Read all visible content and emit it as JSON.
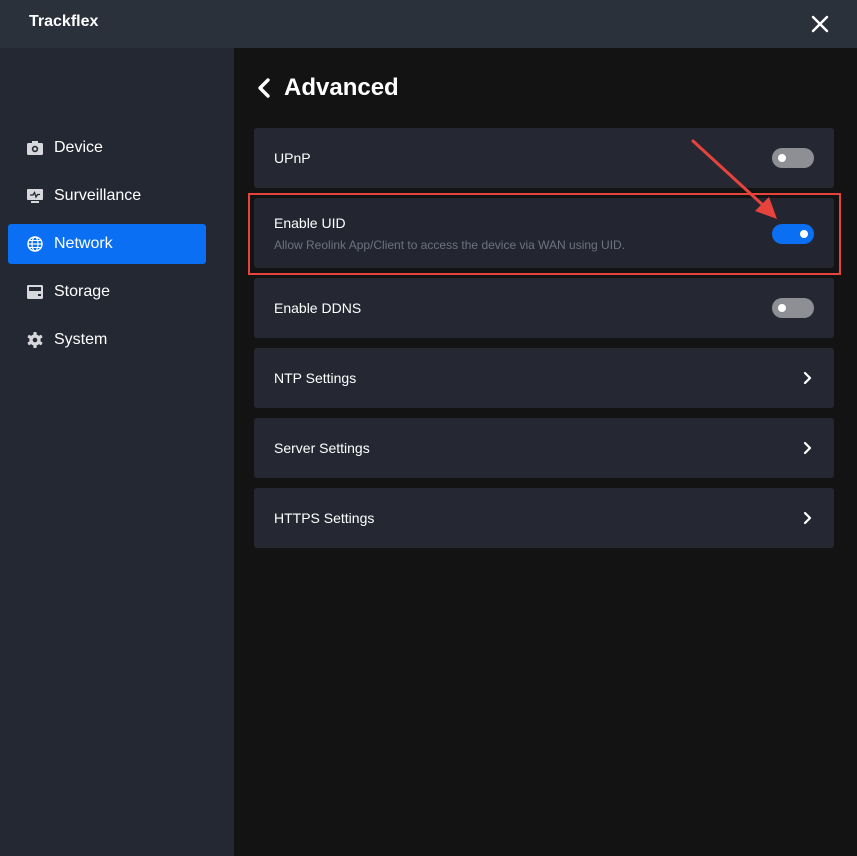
{
  "app": {
    "title": "Trackflex",
    "close_icon": "close-icon"
  },
  "sidebar": {
    "items": [
      {
        "label": "Device",
        "icon": "camera-icon",
        "active": false
      },
      {
        "label": "Surveillance",
        "icon": "monitor-icon",
        "active": false
      },
      {
        "label": "Network",
        "icon": "globe-icon",
        "active": true
      },
      {
        "label": "Storage",
        "icon": "storage-icon",
        "active": false
      },
      {
        "label": "System",
        "icon": "gear-icon",
        "active": false
      }
    ]
  },
  "main": {
    "title": "Advanced",
    "back_icon": "chevron-left-icon",
    "settings": [
      {
        "label": "UPnP",
        "type": "toggle",
        "enabled": false
      },
      {
        "label": "Enable UID",
        "description": "Allow Reolink App/Client to access the device via WAN using UID.",
        "type": "toggle",
        "enabled": true,
        "highlighted": true
      },
      {
        "label": "Enable DDNS",
        "type": "toggle",
        "enabled": false
      },
      {
        "label": "NTP Settings",
        "type": "link"
      },
      {
        "label": "Server Settings",
        "type": "link"
      },
      {
        "label": "HTTPS Settings",
        "type": "link"
      }
    ]
  },
  "colors": {
    "accent": "#0a6ff2",
    "titlebar": "#2b313b",
    "sidebar": "#242832",
    "main_background": "#131313",
    "row_background": "#252833",
    "toggle_off": "#8d8f94",
    "annotation": "#e5433c",
    "description_text": "#6d7280"
  }
}
